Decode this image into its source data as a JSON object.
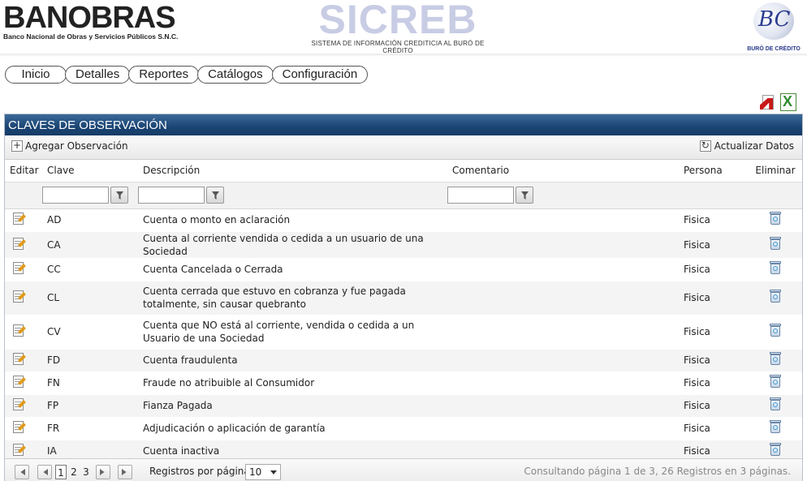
{
  "header": {
    "banobras_logo": "BANOBRAS",
    "banobras_subtitle": "Banco Nacional de Obras y Servicios Públicos S.N.C.",
    "sicreb_logo": "SICREB",
    "sicreb_subtitle": "SISTEMA DE INFORMACIÓN CREDITICIA AL BURÓ DE CRÉDITO",
    "buro_logo": "BC",
    "buro_subtitle": "BURÓ DE CRÉDITO"
  },
  "nav": {
    "items": [
      "Inicio",
      "Detalles",
      "Reportes",
      "Catálogos",
      "Configuración"
    ]
  },
  "export": {
    "pdf_icon": "pdf-export-icon",
    "excel_icon": "excel-export-icon"
  },
  "grid": {
    "title": "CLAVES DE OBSERVACIÓN",
    "add_label": "Agregar Observación",
    "refresh_label": "Actualizar Datos",
    "columns": {
      "edit": "Editar",
      "clave": "Clave",
      "descripcion": "Descripción",
      "comentario": "Comentario",
      "persona": "Persona",
      "eliminar": "Eliminar"
    },
    "filters": {
      "clave": "",
      "descripcion": "",
      "comentario": ""
    },
    "rows": [
      {
        "clave": "AD",
        "descripcion": "Cuenta o monto en aclaración",
        "comentario": "",
        "persona": "Fisica"
      },
      {
        "clave": "CA",
        "descripcion": "Cuenta al corriente vendida o cedida a un usuario de una Sociedad",
        "comentario": "",
        "persona": "Fisica"
      },
      {
        "clave": "CC",
        "descripcion": "Cuenta Cancelada o Cerrada",
        "comentario": "",
        "persona": "Fisica"
      },
      {
        "clave": "CL",
        "descripcion": "Cuenta cerrada que estuvo en cobranza y fue pagada totalmente, sin causar quebranto",
        "comentario": "",
        "persona": "Fisica"
      },
      {
        "clave": "CV",
        "descripcion": "Cuenta que NO está al corriente, vendida o cedida a un Usuario de una Sociedad",
        "comentario": "",
        "persona": "Fisica"
      },
      {
        "clave": "FD",
        "descripcion": "Cuenta fraudulenta",
        "comentario": "",
        "persona": "Fisica"
      },
      {
        "clave": "FN",
        "descripcion": "Fraude no atribuible al Consumidor",
        "comentario": "",
        "persona": "Fisica"
      },
      {
        "clave": "FP",
        "descripcion": "Fianza Pagada",
        "comentario": "",
        "persona": "Fisica"
      },
      {
        "clave": "FR",
        "descripcion": "Adjudicación o aplicación de garantía",
        "comentario": "",
        "persona": "Fisica"
      },
      {
        "clave": "IA",
        "descripcion": "Cuenta inactiva",
        "comentario": "",
        "persona": "Fisica"
      }
    ]
  },
  "pager": {
    "pages": [
      "1",
      "2",
      "3"
    ],
    "current_page": "1",
    "per_page_label": "Registros por página:",
    "per_page_value": "10",
    "status": "Consultando página 1 de 3, 26 Registros en 3 páginas."
  }
}
